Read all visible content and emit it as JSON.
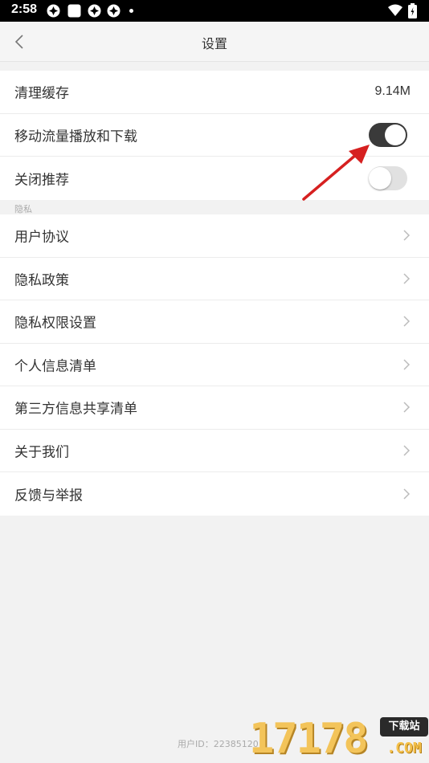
{
  "status_bar": {
    "time": "2:58"
  },
  "header": {
    "title": "设置",
    "back_icon": "chevron-left-icon"
  },
  "general": {
    "cache": {
      "label": "清理缓存",
      "value": "9.14M"
    },
    "mobile_data": {
      "label": "移动流量播放和下载",
      "enabled": true
    },
    "recommend": {
      "label": "关闭推荐",
      "enabled": false
    }
  },
  "privacy": {
    "section_label": "隐私",
    "items": [
      {
        "label": "用户协议"
      },
      {
        "label": "隐私政策"
      },
      {
        "label": "隐私权限设置"
      },
      {
        "label": "个人信息清单"
      },
      {
        "label": "第三方信息共享清单"
      },
      {
        "label": "关于我们"
      },
      {
        "label": "反馈与举报"
      }
    ]
  },
  "footer": {
    "user_id": "用户ID：22385120"
  },
  "watermark": {
    "digits": "17178",
    "badge": "下载站",
    "domain": ".COM"
  },
  "colors": {
    "toggle_on": "#3a3a3a",
    "toggle_off": "#e1e1e1",
    "annotation_arrow": "#d62020",
    "background": "#f2f2f2"
  }
}
